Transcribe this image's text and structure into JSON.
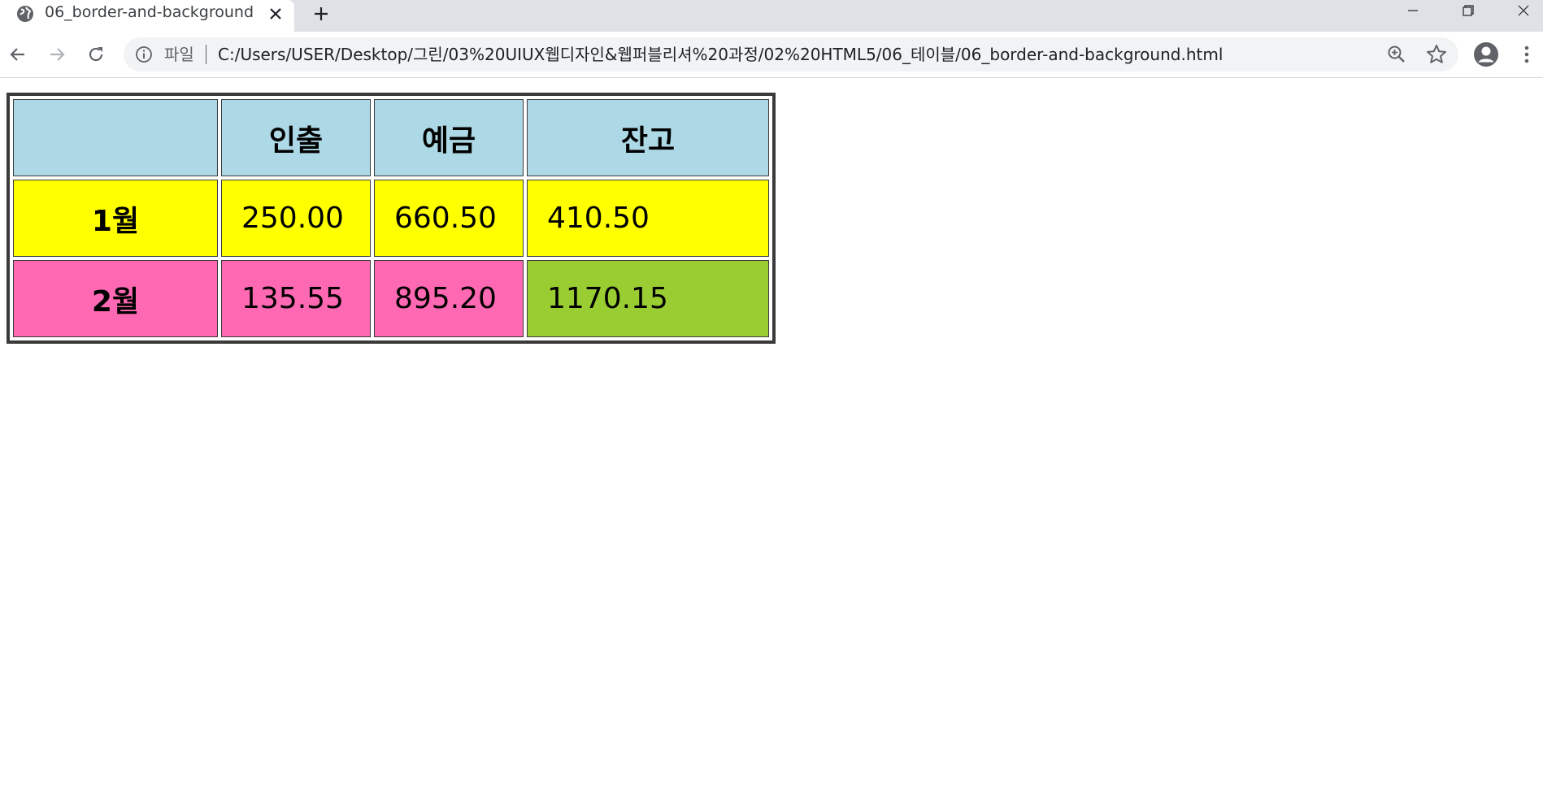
{
  "browser": {
    "tab_title": "06_border-and-background",
    "scheme_label": "파일",
    "url": "C:/Users/USER/Desktop/그린/03%20UIUX웹디자인&웹퍼블리셔%20과정/02%20HTML5/06_테이블/06_border-and-background.html",
    "icons": {
      "favicon": "globe-icon",
      "tab_close": "close-icon",
      "new_tab": "plus-icon",
      "minimize": "minimize-icon",
      "maximize": "restore-icon",
      "window_close": "close-icon",
      "back": "arrow-left-icon",
      "forward": "arrow-right-icon",
      "reload": "reload-icon",
      "info": "info-icon",
      "zoom": "zoom-icon",
      "bookmark": "star-icon",
      "profile": "account-icon",
      "menu": "kebab-menu-icon"
    }
  },
  "table": {
    "headers": [
      "",
      "인출",
      "예금",
      "잔고"
    ],
    "rows": [
      {
        "month": "1월",
        "withdrawal": "250.00",
        "deposit": "660.50",
        "balance": "410.50"
      },
      {
        "month": "2월",
        "withdrawal": "135.55",
        "deposit": "895.20",
        "balance": "1170.15"
      }
    ],
    "colors": {
      "header_bg": "#add8e6",
      "jan_bg": "#ffff00",
      "feb_bg": "#ff69b4",
      "feb_balance_bg": "#9acd32",
      "border": "#3a3a3a"
    }
  }
}
